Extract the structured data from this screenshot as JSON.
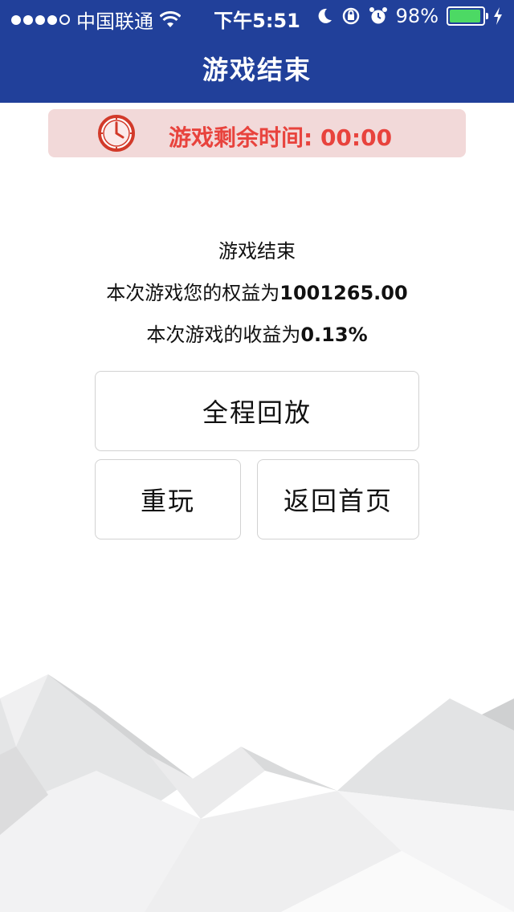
{
  "status_bar": {
    "carrier": "中国联通",
    "time": "下午5:51",
    "battery": "98%",
    "battery_level": 0.98,
    "signal_bars": 4,
    "signal_max": 5,
    "icons": [
      "wifi-icon",
      "moon-icon",
      "rotation-lock-icon",
      "alarm-icon",
      "battery-icon",
      "charging-icon"
    ]
  },
  "header": {
    "title": "游戏结束"
  },
  "timer": {
    "label": "游戏剩余时间: 00:00",
    "icon": "clock-icon",
    "color": "#e8433d"
  },
  "result": {
    "heading": "游戏结束",
    "equity_label": "本次游戏您的权益为",
    "equity_value": "1001265.00",
    "return_label": "本次游戏的收益为",
    "return_value": "0.13%"
  },
  "buttons": {
    "replay_all": "全程回放",
    "play_again": "重玩",
    "home": "返回首页"
  },
  "colors": {
    "header_bg": "#21409a",
    "banner_bg": "#f2d9d9",
    "accent": "#e8433d",
    "battery": "#4cd964"
  }
}
